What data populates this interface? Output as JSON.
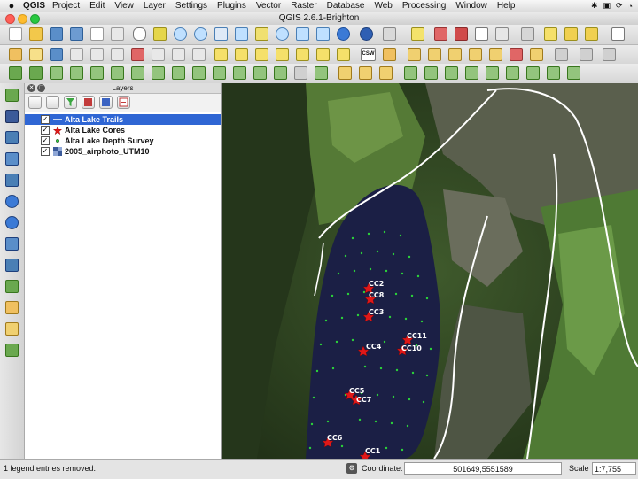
{
  "menubar": {
    "app_name": "QGIS",
    "menus": [
      "Project",
      "Edit",
      "View",
      "Layer",
      "Settings",
      "Plugins",
      "Vector",
      "Raster",
      "Database",
      "Web",
      "Processing",
      "Window",
      "Help"
    ]
  },
  "window": {
    "title": "QGIS 2.6.1-Brighton"
  },
  "layers_panel": {
    "title": "Layers",
    "layers": [
      {
        "name": "Alta Lake Trails",
        "checked": true,
        "selected": true,
        "symbol": "line-icon"
      },
      {
        "name": "Alta Lake Cores",
        "checked": true,
        "selected": false,
        "symbol": "star-icon"
      },
      {
        "name": "Alta Lake Depth Survey",
        "checked": true,
        "selected": false,
        "symbol": "point-icon"
      },
      {
        "name": "2005_airphoto_UTM10",
        "checked": true,
        "selected": false,
        "symbol": "raster-icon"
      }
    ]
  },
  "map": {
    "core_labels": [
      "CC2",
      "CC8",
      "CC3",
      "CC4",
      "CC11",
      "CC10",
      "CC5",
      "CC7",
      "CC6",
      "CC1"
    ]
  },
  "toolbar": {
    "csw_label": "CSW"
  },
  "statusbar": {
    "message": "1 legend entries removed.",
    "coordinate_label": "Coordinate:",
    "coordinate_value": "501649,5551589",
    "scale_label": "Scale",
    "scale_value": "1:7,755"
  },
  "colors": {
    "selection": "#2f66d4",
    "trail": "#ffffff",
    "core_marker": "#e01818",
    "depth_point": "#2bd13a",
    "lake": "#1b1f45"
  }
}
